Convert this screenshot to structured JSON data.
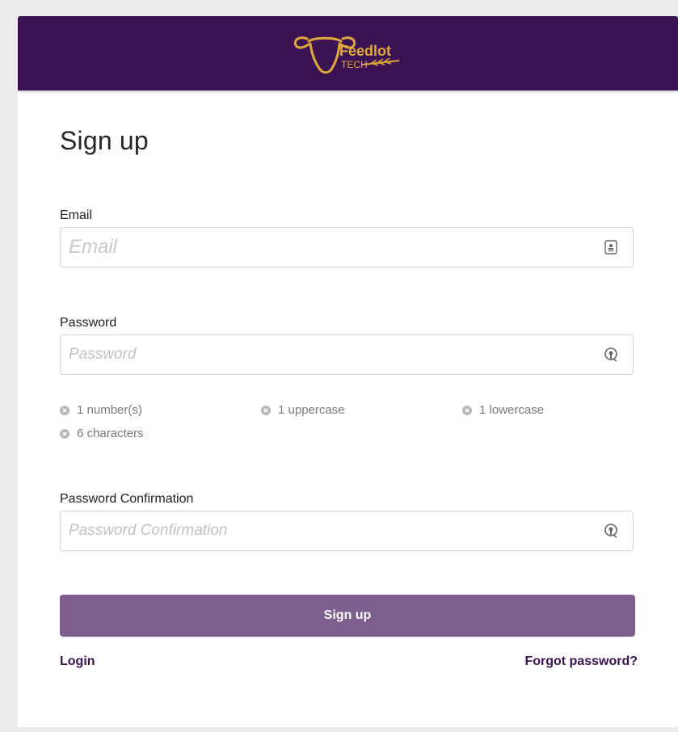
{
  "brand": {
    "logo_name": "Feedlot",
    "logo_sub": "TECH",
    "bar_color": "#3b1252",
    "logo_color": "#e0a83a"
  },
  "form": {
    "title": "Sign up",
    "email": {
      "label": "Email",
      "placeholder": "Email",
      "icon": "contact-card-icon"
    },
    "password": {
      "label": "Password",
      "placeholder": "Password",
      "icon": "password-key-icon",
      "rules": [
        "1 number(s)",
        "1 uppercase",
        "1 lowercase",
        "6 characters"
      ]
    },
    "password_confirmation": {
      "label": "Password Confirmation",
      "placeholder": "Password Confirmation",
      "icon": "password-key-icon"
    },
    "submit_label": "Sign up",
    "submit_color": "#7e5e8d",
    "login_link": "Login",
    "forgot_link": "Forgot password?"
  }
}
